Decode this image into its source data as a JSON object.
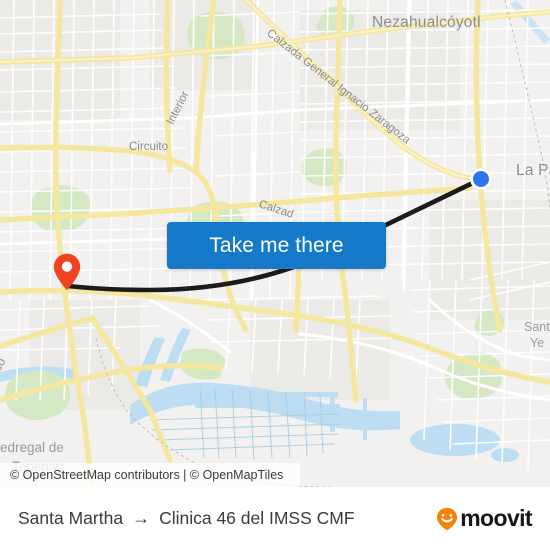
{
  "map": {
    "background_color": "#f2f1ef",
    "road_color": "#ffffff",
    "highway_color": "#f7e8a5",
    "park_color": "#d6e8c6",
    "water_color": "#b9dcf2",
    "labels": [
      {
        "id": "neza",
        "text": "Nezahualcóyotl",
        "kind": "city"
      },
      {
        "id": "lapaz",
        "text": "La Pa",
        "kind": "city"
      },
      {
        "id": "circuito",
        "text": "Circuito",
        "kind": "road"
      },
      {
        "id": "interior",
        "text": "Interior",
        "kind": "road"
      },
      {
        "id": "zaragoza",
        "text": "Calzada General Ignacio Zaragoza",
        "kind": "road"
      },
      {
        "id": "calzad",
        "text": "Calzad",
        "kind": "road"
      },
      {
        "id": "pedregal",
        "text": "edregal de",
        "kind": "neighborhood"
      },
      {
        "id": "tepepan",
        "text": "Tepepan",
        "kind": "neighborhood"
      },
      {
        "id": "co",
        "text": "co",
        "kind": "road"
      },
      {
        "id": "santa",
        "text": "Sant",
        "kind": "neighborhood"
      },
      {
        "id": "ye",
        "text": "Ye",
        "kind": "neighborhood"
      }
    ],
    "markers": {
      "origin": {
        "name": "origin-dot",
        "color": "#2a75ea"
      },
      "destination": {
        "name": "destination-pin",
        "color": "#ef4423"
      }
    },
    "route": {
      "color": "#1a1a1a"
    }
  },
  "cta": {
    "label": "Take me there",
    "color": "#1479c9"
  },
  "attribution": {
    "text": "© OpenStreetMap contributors | © OpenMapTiles"
  },
  "footer": {
    "origin": "Santa Martha",
    "arrow": "→",
    "destination": "Clinica 46 del IMSS CMF",
    "brand": "moovit",
    "brand_accent": "#f5820b"
  }
}
